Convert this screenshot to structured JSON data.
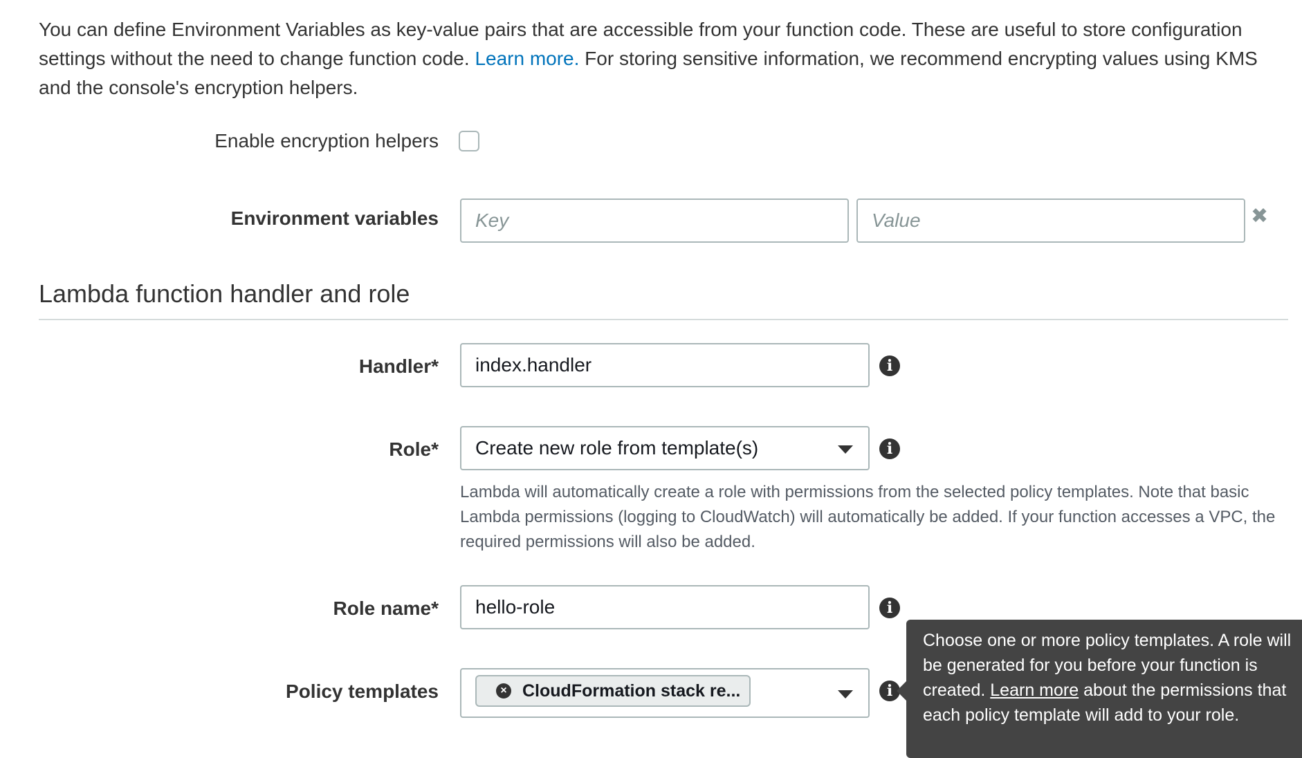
{
  "intro": {
    "text_before": "You can define Environment Variables as key-value pairs that are accessible from your function code. These are useful to store configuration settings without the need to change function code. ",
    "learn_more": "Learn more.",
    "text_after": " For storing sensitive information, we recommend encrypting values using KMS and the console's encryption helpers."
  },
  "encryption": {
    "label": "Enable encryption helpers",
    "checked": false
  },
  "env_vars": {
    "label": "Environment variables",
    "key_placeholder": "Key",
    "value_placeholder": "Value",
    "remove_icon": "close-icon"
  },
  "section": {
    "title": "Lambda function handler and role"
  },
  "handler": {
    "label": "Handler*",
    "value": "index.handler"
  },
  "role": {
    "label": "Role*",
    "selected": "Create new role from template(s)",
    "help": "Lambda will automatically create a role with permissions from the selected policy templates. Note that basic Lambda permissions (logging to CloudWatch) will automatically be added. If your function accesses a VPC, the required permissions will also be added."
  },
  "role_name": {
    "label": "Role name*",
    "value": "hello-role"
  },
  "policy_templates": {
    "label": "Policy templates",
    "token": "CloudFormation stack re..."
  },
  "tooltip": {
    "text_before": "Choose one or more policy templates. A role will be generated for you before your function is created. ",
    "link": "Learn more",
    "text_after": " about the permissions that each policy template will add to your role."
  },
  "colors": {
    "link": "#0073bb",
    "tooltip_bg": "#444444",
    "border": "#aab7b8"
  }
}
